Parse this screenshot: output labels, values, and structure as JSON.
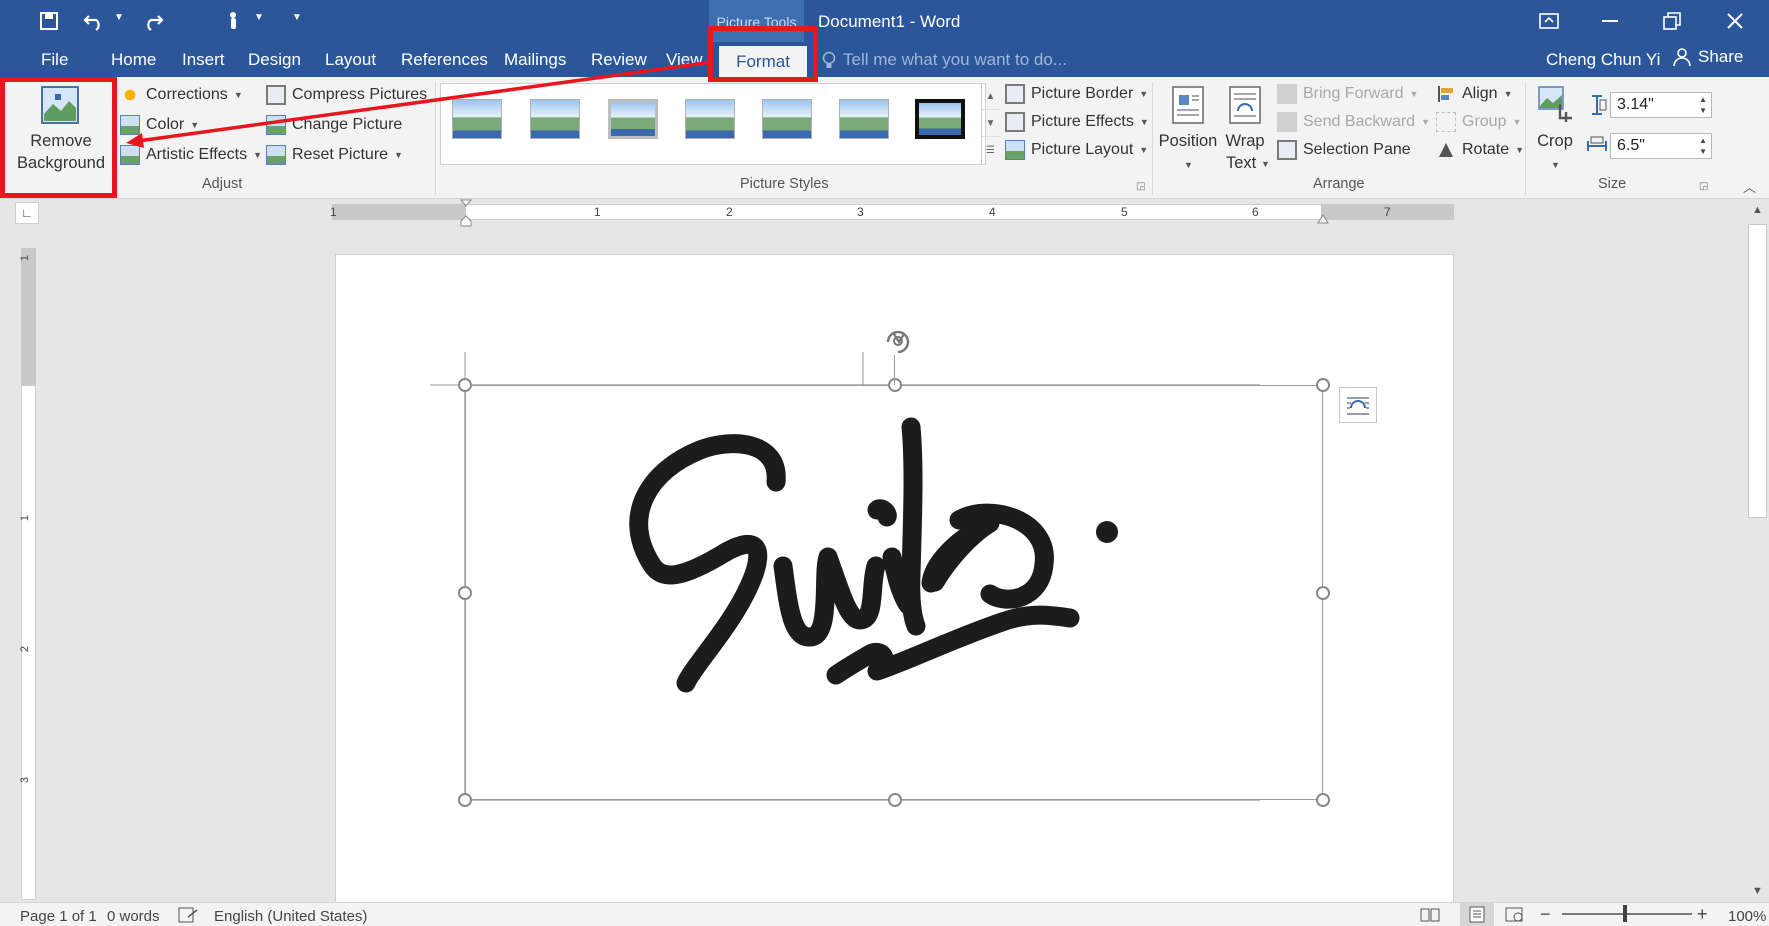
{
  "window": {
    "doc_title": "Document1 - Word",
    "context_tab_label": "Picture Tools"
  },
  "qat": {
    "save_icon": "save-icon",
    "undo_icon": "undo-icon",
    "redo_icon": "redo-icon",
    "touch_icon": "touch-mode-icon",
    "customize_icon": "customize-qat-icon"
  },
  "tabs": [
    "File",
    "Home",
    "Insert",
    "Design",
    "Layout",
    "References",
    "Mailings",
    "Review",
    "View"
  ],
  "active_tab": "Format",
  "tell_me_placeholder": "Tell me what you want to do...",
  "user": {
    "name": "Cheng Chun Yi",
    "share_label": "Share"
  },
  "ribbon": {
    "adjust": {
      "remove_bg_line1": "Remove",
      "remove_bg_line2": "Background",
      "corrections": "Corrections",
      "color": "Color",
      "artistic_effects": "Artistic Effects",
      "compress_pictures": "Compress Pictures",
      "change_picture": "Change Picture",
      "reset_picture": "Reset Picture",
      "group_label": "Adjust"
    },
    "picture_styles": {
      "picture_border": "Picture Border",
      "picture_effects": "Picture Effects",
      "picture_layout": "Picture Layout",
      "group_label": "Picture Styles"
    },
    "arrange": {
      "position": "Position",
      "wrap_line1": "Wrap",
      "wrap_line2": "Text",
      "bring_forward": "Bring Forward",
      "send_backward": "Send Backward",
      "selection_pane": "Selection Pane",
      "align": "Align",
      "group": "Group",
      "rotate": "Rotate",
      "group_label": "Arrange"
    },
    "size": {
      "crop": "Crop",
      "height": "3.14\"",
      "width": "6.5\"",
      "group_label": "Size"
    }
  },
  "ruler": {
    "h_numbers": [
      "1",
      "1",
      "2",
      "3",
      "4",
      "5",
      "6",
      "7"
    ],
    "v_numbers": [
      "1",
      "1",
      "2",
      "3"
    ]
  },
  "document": {
    "signature_text": "Sumiko"
  },
  "status": {
    "page": "Page 1 of 1",
    "words": "0 words",
    "language": "English (United States)",
    "zoom": "100%"
  },
  "colors": {
    "word_blue": "#2b579a",
    "annotation_red": "#e8161e"
  }
}
